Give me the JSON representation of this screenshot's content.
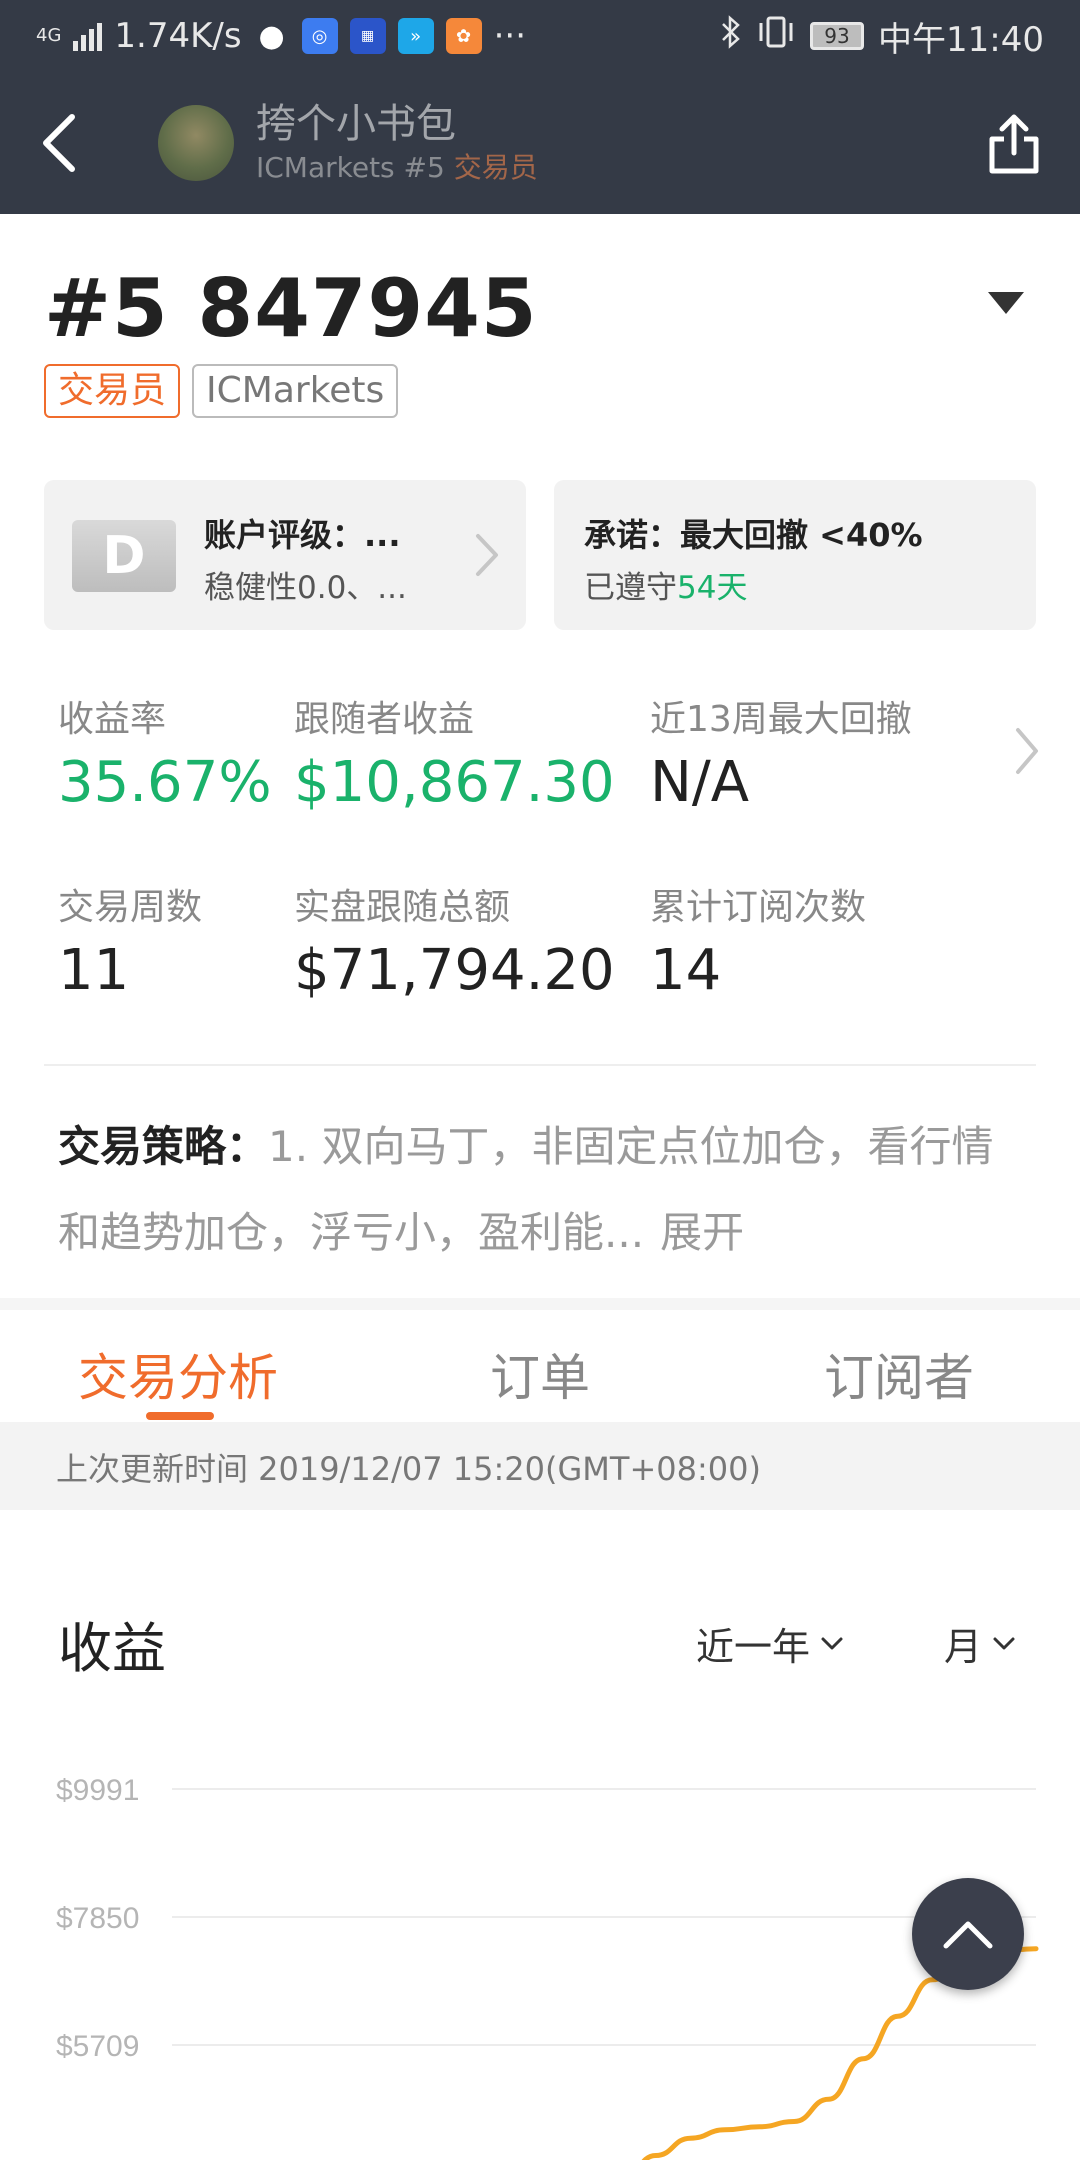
{
  "status_bar": {
    "network_type": "4G",
    "speed": "1.74K/s",
    "more": "···",
    "battery": "93",
    "time": "中午11:40",
    "app_icons": [
      "wechat-icon",
      "qq-browser-icon",
      "autohome-icon",
      "message-icon",
      "uc-browser-icon"
    ]
  },
  "app_bar": {
    "name": "挎个小书包",
    "broker": "ICMarkets #5",
    "role": "交易员"
  },
  "account": {
    "id": "#5 847945",
    "tags": [
      "交易员",
      "ICMarkets"
    ]
  },
  "rating_card": {
    "grade": "D",
    "title": "账户评级：...",
    "subtitle": "稳健性0.0、..."
  },
  "promise_card": {
    "title": "承诺：最大回撤 <40%",
    "kept_prefix": "已遵守",
    "kept_days": "54天"
  },
  "stats": [
    {
      "label": "收益率",
      "value": "35.67%"
    },
    {
      "label": "跟随者收益",
      "value": "$10,867.30"
    },
    {
      "label": "近13周最大回撤",
      "value": "N/A"
    },
    {
      "label": "交易周数",
      "value": "11"
    },
    {
      "label": "实盘跟随总额",
      "value": "$71,794.20"
    },
    {
      "label": "累计订阅次数",
      "value": "14"
    }
  ],
  "strategy": {
    "label": "交易策略：",
    "text": "1. 双向马丁，非固定点位加仓，看行情和趋势加仓，浮亏小，盈利能...",
    "expand": "展开"
  },
  "tabs": [
    "交易分析",
    "订单",
    "订阅者"
  ],
  "active_tab": 0,
  "update_text": "上次更新时间 2019/12/07 15:20(GMT+08:00)",
  "chart_section": {
    "title": "收益",
    "range_filter": "近一年",
    "period_filter": "月"
  },
  "colors": {
    "accent": "#f06c2c",
    "positive": "#1ab26b",
    "header_bg": "#343a46",
    "line": "#f5a623"
  },
  "chart_data": {
    "type": "line",
    "title": "收益",
    "y_tick_labels": [
      "$9991",
      "$7850",
      "$5709"
    ],
    "ylim": [
      3568,
      9991
    ],
    "grid": true,
    "series": [
      {
        "x": [
          0.52,
          0.56,
          0.6,
          0.64,
          0.68,
          0.72,
          0.76,
          0.8,
          0.84,
          0.88,
          0.92,
          0.95,
          1.0
        ],
        "values": [
          3440,
          3860,
          4150,
          4290,
          4340,
          4430,
          4800,
          5480,
          6190,
          6800,
          7170,
          7270,
          7320
        ]
      }
    ]
  }
}
